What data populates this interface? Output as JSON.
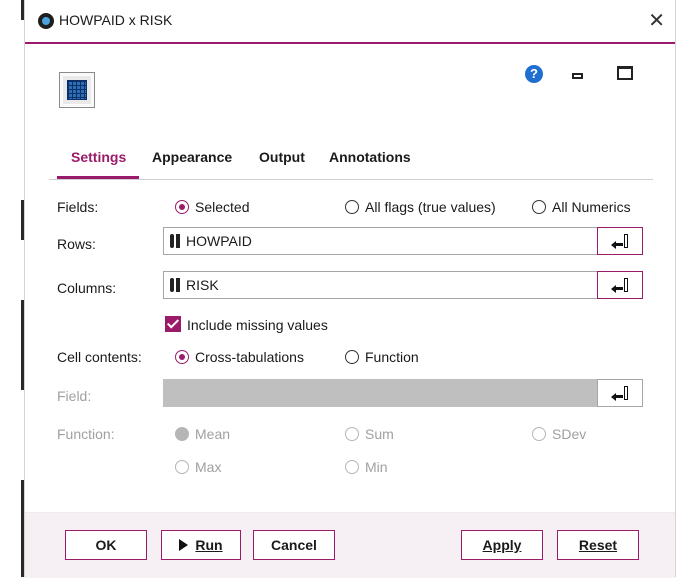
{
  "window": {
    "title": "HOWPAID x RISK"
  },
  "header_icons": [
    "table-node-icon",
    "help-icon",
    "minimize-icon",
    "maximize-icon"
  ],
  "tabs": [
    {
      "label": "Settings",
      "active": true
    },
    {
      "label": "Appearance",
      "active": false
    },
    {
      "label": "Output",
      "active": false
    },
    {
      "label": "Annotations",
      "active": false
    }
  ],
  "form": {
    "fields_label": "Fields:",
    "fields_options": [
      {
        "label": "Selected",
        "selected": true
      },
      {
        "label": "All flags (true values)",
        "selected": false
      },
      {
        "label": "All Numerics",
        "selected": false
      }
    ],
    "rows_label": "Rows:",
    "rows_value": "HOWPAID",
    "columns_label": "Columns:",
    "columns_value": "RISK",
    "include_missing_label": "Include missing values",
    "include_missing_checked": true,
    "cell_contents_label": "Cell contents:",
    "cell_contents_options": [
      {
        "label": "Cross-tabulations",
        "selected": true
      },
      {
        "label": "Function",
        "selected": false
      }
    ],
    "field_label": "Field:",
    "field_value": "",
    "function_label": "Function:",
    "function_options": [
      {
        "label": "Mean",
        "selected": true
      },
      {
        "label": "Sum",
        "selected": false
      },
      {
        "label": "SDev",
        "selected": false
      },
      {
        "label": "Max",
        "selected": false
      },
      {
        "label": "Min",
        "selected": false
      }
    ]
  },
  "buttons": {
    "ok": "OK",
    "run": "Run",
    "cancel": "Cancel",
    "apply": "Apply",
    "reset": "Reset"
  },
  "colors": {
    "accent": "#9b1b6b",
    "help_blue": "#1f6fd1",
    "disabled_gray": "#bfbfbf",
    "footer_bg": "#f6f0f5"
  }
}
